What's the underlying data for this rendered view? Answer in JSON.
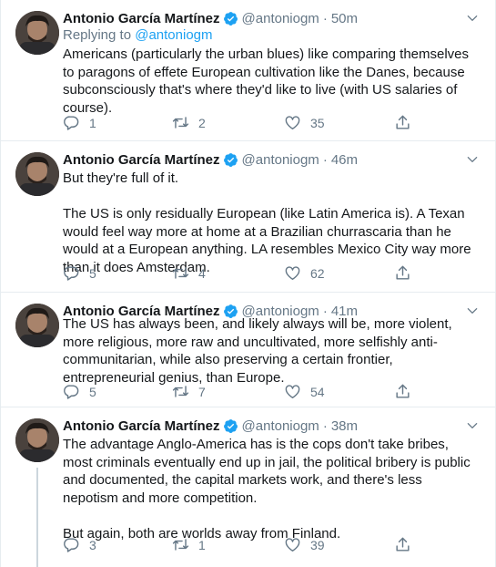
{
  "colors": {
    "accent": "#1da1f2",
    "muted": "#657786",
    "divider": "#e6ecf0",
    "text": "#14171a"
  },
  "tweets": [
    {
      "name": "Antonio García Martínez",
      "handle": "@antoniogm",
      "separator": "·",
      "time": "50m",
      "replying_prefix": "Replying to",
      "replying_handle": "@antoniogm",
      "paragraphs": [
        "Americans (particularly the urban blues) like comparing themselves to paragons of effete European cultivation like the Danes, because subconsciously that's where they'd like to live (with US salaries of course)."
      ],
      "replies": "1",
      "retweets": "2",
      "likes": "35"
    },
    {
      "name": "Antonio García Martínez",
      "handle": "@antoniogm",
      "separator": "·",
      "time": "46m",
      "paragraphs": [
        "But they're full of it.",
        "The US is only residually European (like Latin America is). A Texan would feel way more at home at a Brazilian churrascaria than he would at a European anything. LA resembles Mexico City way more than it does Amsterdam."
      ],
      "replies": "5",
      "retweets": "4",
      "likes": "62"
    },
    {
      "name": "Antonio García Martínez",
      "handle": "@antoniogm",
      "separator": "·",
      "time": "41m",
      "paragraphs": [
        "The US has always been, and likely always will be, more violent, more religious, more raw and uncultivated, more selfishly anti-communitarian, while also preserving a certain frontier, entrepreneurial genius, than Europe."
      ],
      "replies": "5",
      "retweets": "7",
      "likes": "54"
    },
    {
      "name": "Antonio García Martínez",
      "handle": "@antoniogm",
      "separator": "·",
      "time": "38m",
      "paragraphs": [
        "The advantage Anglo-America has is the cops don't take bribes, most criminals eventually end up in jail, the political bribery is public and documented, the capital markets work, and there's less nepotism and more competition.",
        "But again, both are worlds away from Finland."
      ],
      "replies": "3",
      "retweets": "1",
      "likes": "39"
    }
  ],
  "icons": {
    "verified": "verified-badge-icon",
    "more": "chevron-down-icon",
    "reply": "reply-icon",
    "retweet": "retweet-icon",
    "like": "like-icon",
    "share": "share-icon"
  }
}
